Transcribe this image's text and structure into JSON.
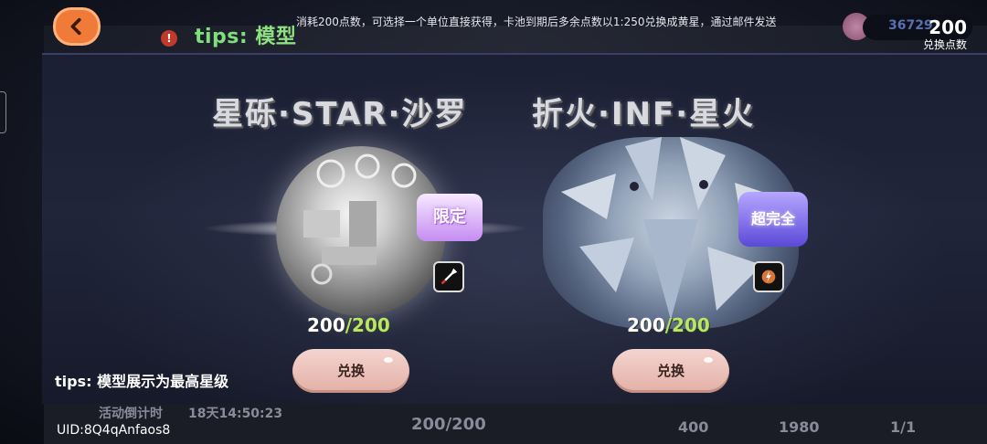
{
  "header": {
    "tips_label": "tips:",
    "tips_topic": "模型",
    "tips_text": "消耗200点数，可选择一个单位直接获得，卡池到期后多余点数以1:250兑换成黄星，通过邮件发送",
    "points_background": "36729",
    "points_value": "200",
    "points_label": "兑换点数"
  },
  "background": {
    "countdown_label": "活动倒计时",
    "countdown_value": "18天14:50:23",
    "bottom_progress": "200/200",
    "stat1": "400",
    "stat2": "1980",
    "stat3": "1/1"
  },
  "cards": [
    {
      "title": "星砾·STAR·沙罗",
      "badge": "限定",
      "type_icon": "sword-icon",
      "progress_current": "200",
      "progress_max": "/200",
      "button_label": "兑换"
    },
    {
      "title": "折火·INF·星火",
      "badge": "超完全",
      "type_icon": "lightning-icon",
      "progress_current": "200",
      "progress_max": "/200",
      "button_label": "兑换"
    }
  ],
  "footer": {
    "tips": "tips: 模型展示为最高星级",
    "uid": "UID:8Q4qAnfaos8"
  },
  "colors": {
    "accent_orange": "#f07b38",
    "tips_green": "#7ee07a",
    "progress_green": "#b8e85f",
    "button_pink": "#e2b0a6"
  }
}
